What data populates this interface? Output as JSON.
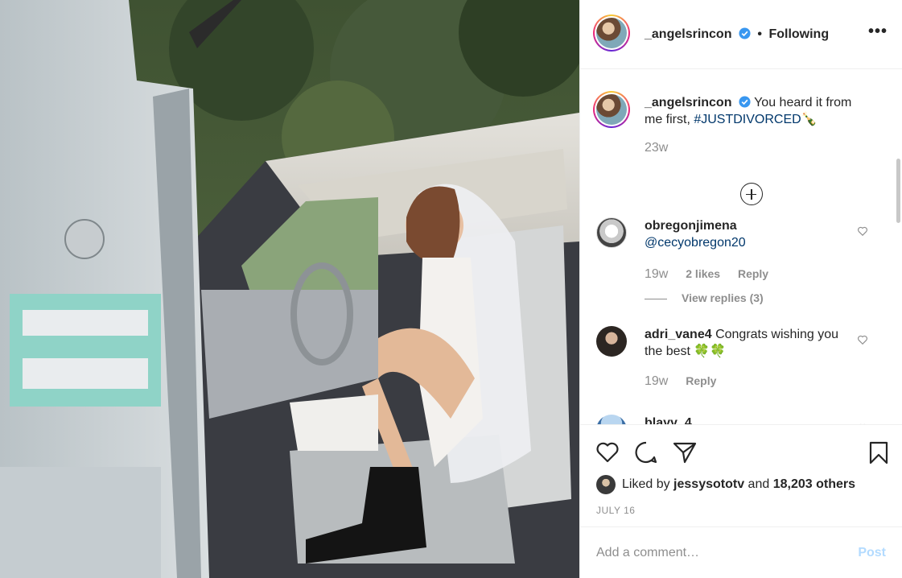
{
  "post": {
    "username": "_angelsrincon",
    "follow_status": "Following",
    "separator": "•",
    "more": "•••"
  },
  "caption": {
    "username": "_angelsrincon",
    "text": "You heard it from me first,",
    "hashtag": "#JUSTDIVORCED",
    "emoji": "🍾",
    "time": "23w"
  },
  "comments": [
    {
      "username": "obregonjimena",
      "mention": "@cecyobregon20",
      "text": "",
      "time": "19w",
      "likes": "2 likes",
      "reply": "Reply",
      "view_replies": "View replies (3)"
    },
    {
      "username": "adri_vane4",
      "mention": "",
      "text": "Congrats wishing you the best 🍀🍀",
      "time": "19w",
      "likes": "",
      "reply": "Reply",
      "view_replies": ""
    },
    {
      "username": "blayy_4",
      "mention": "",
      "text": "",
      "time": "",
      "likes": "",
      "reply": "",
      "view_replies": ""
    }
  ],
  "likes": {
    "prefix": "Liked by",
    "user": "jessysototv",
    "and": "and",
    "others": "18,203 others"
  },
  "date": "JULY 16",
  "add_comment": {
    "placeholder": "Add a comment…",
    "post_label": "Post"
  },
  "icons": {
    "verified": "verified-badge-icon",
    "like": "heart-icon",
    "comment": "comment-bubble-icon",
    "share": "paper-plane-icon",
    "save": "bookmark-icon",
    "load_more": "plus-circle-icon"
  },
  "colors": {
    "link": "#00376b",
    "muted": "#8e8e8e",
    "verified": "#3897f0",
    "post_disabled": "#b3dbff"
  }
}
